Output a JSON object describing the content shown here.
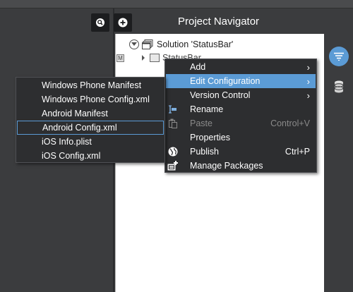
{
  "navigator": {
    "title": "Project Navigator",
    "search_icon": "search-icon",
    "add_icon": "add-icon"
  },
  "tree": {
    "solution_label": "Solution 'StatusBar'",
    "project_badge": "M",
    "project_label": "StatusBar"
  },
  "context_menu": {
    "items": [
      {
        "label": "Add",
        "submenu": true
      },
      {
        "label": "Edit Configuration",
        "submenu": true
      },
      {
        "label": "Version Control",
        "submenu": true
      },
      {
        "label": "Rename",
        "icon": "rename-icon"
      },
      {
        "label": "Paste",
        "shortcut": "Control+V",
        "disabled": true,
        "icon": "paste-icon"
      },
      {
        "label": "Properties"
      },
      {
        "label": "Publish",
        "shortcut": "Ctrl+P",
        "icon": "globe-icon"
      },
      {
        "label": "Manage Packages",
        "icon": "packages-icon"
      }
    ]
  },
  "submenu": {
    "items": [
      {
        "label": "Windows Phone Manifest"
      },
      {
        "label": "Windows Phone Config.xml"
      },
      {
        "label": "Android Manifest"
      },
      {
        "label": "Android Config.xml"
      },
      {
        "label": "iOS Info.plist"
      },
      {
        "label": "iOS Config.xml"
      }
    ]
  },
  "colors": {
    "accent": "#5b9bd5",
    "menu_bg": "#2d2e30",
    "panel_bg": "#3b3c3e"
  }
}
